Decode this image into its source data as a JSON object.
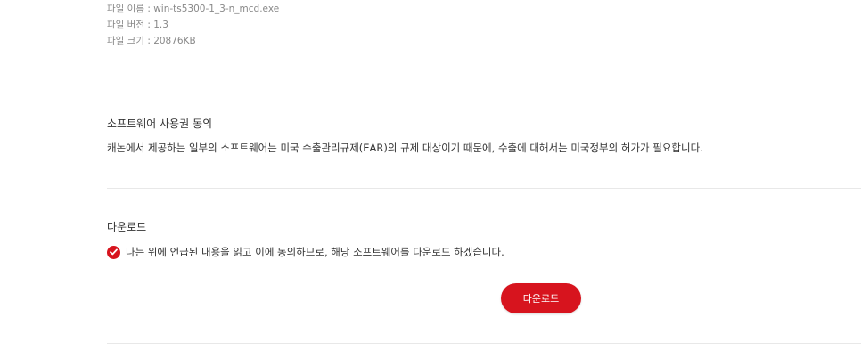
{
  "file_info": {
    "name": "파일 이름 : win-ts5300-1_3-n_mcd.exe",
    "version": "파일 버전 : 1.3",
    "size": "파일 크기 : 20876KB"
  },
  "license": {
    "title": "소프트웨어 사용권 동의",
    "text": "캐논에서 제공하는 일부의 소프트웨어는 미국 수출관리규제(EAR)의 규제 대상이기 때문에, 수출에 대해서는 미국정부의 허가가 필요합니다."
  },
  "download": {
    "title": "다운로드",
    "agree_label": "나는 위에 언급된 내용을 읽고 이에 동의하므로, 해당 소프트웨어를 다운로드 하겠습니다.",
    "agree_checked": true,
    "button_label": "다운로드"
  },
  "colors": {
    "accent": "#d7141e",
    "divider": "#e8e8e8",
    "text": "#333333",
    "muted": "#888888"
  },
  "icons": {
    "agree_checkbox": "check-circle-icon"
  }
}
